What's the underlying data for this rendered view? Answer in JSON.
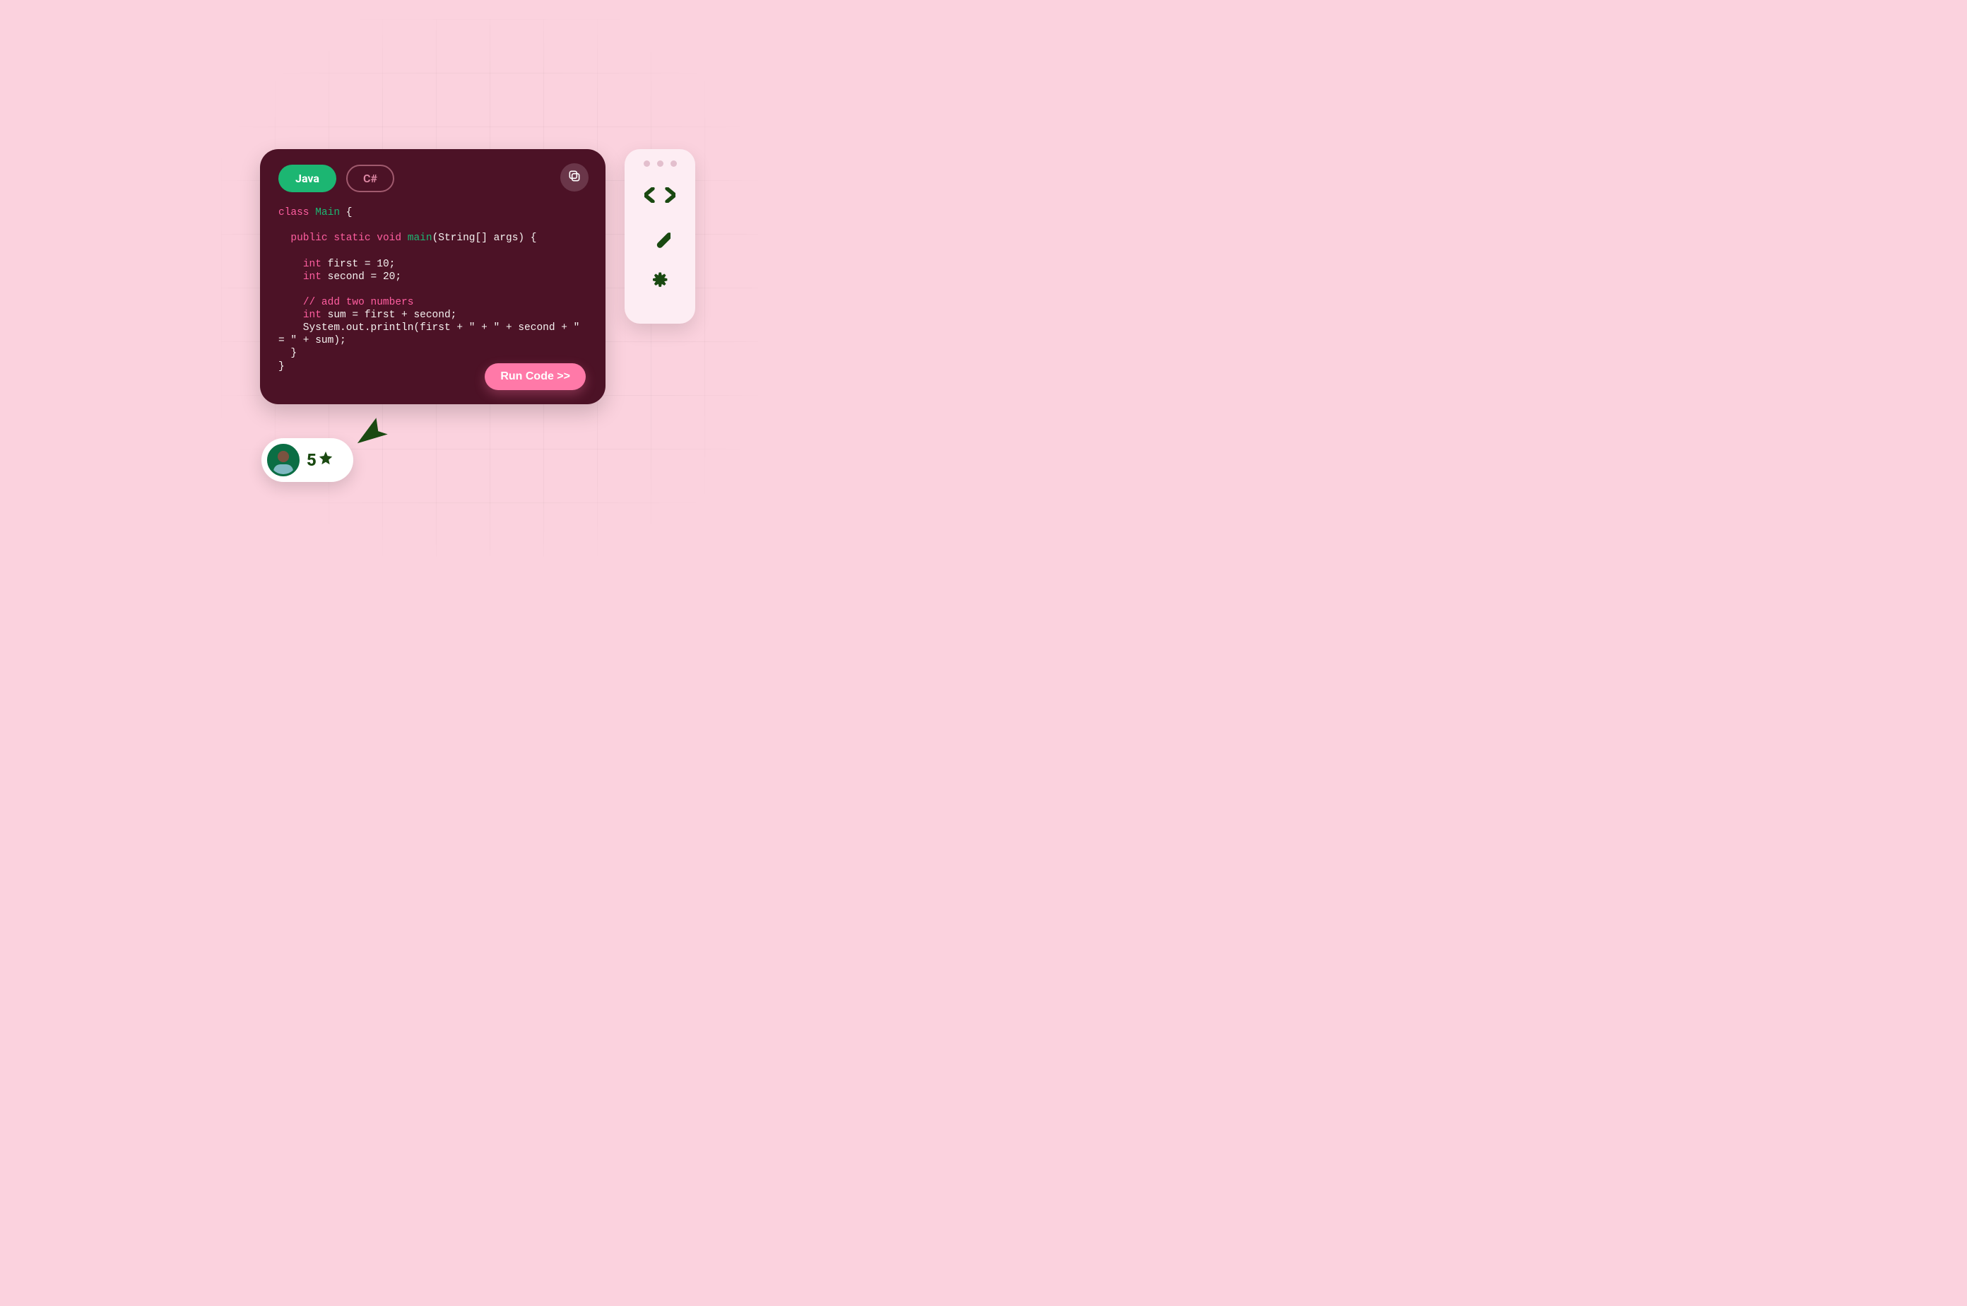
{
  "editor": {
    "tabs": [
      {
        "label": "Java",
        "active": true
      },
      {
        "label": "C#",
        "active": false
      }
    ],
    "run_label": "Run Code >>",
    "code_tokens": [
      {
        "t": "kw",
        "s": "class"
      },
      {
        "t": "",
        "s": " "
      },
      {
        "t": "type",
        "s": "Main"
      },
      {
        "t": "",
        "s": " {"
      },
      {
        "t": "nl"
      },
      {
        "t": "nl"
      },
      {
        "t": "",
        "s": "  "
      },
      {
        "t": "kw",
        "s": "public"
      },
      {
        "t": "",
        "s": " "
      },
      {
        "t": "kw",
        "s": "static"
      },
      {
        "t": "",
        "s": " "
      },
      {
        "t": "kw",
        "s": "void"
      },
      {
        "t": "",
        "s": " "
      },
      {
        "t": "fn",
        "s": "main"
      },
      {
        "t": "",
        "s": "(String[] args) {"
      },
      {
        "t": "nl"
      },
      {
        "t": "nl"
      },
      {
        "t": "",
        "s": "    "
      },
      {
        "t": "kw",
        "s": "int"
      },
      {
        "t": "",
        "s": " first = "
      },
      {
        "t": "num",
        "s": "10"
      },
      {
        "t": "",
        "s": ";"
      },
      {
        "t": "nl"
      },
      {
        "t": "",
        "s": "    "
      },
      {
        "t": "kw",
        "s": "int"
      },
      {
        "t": "",
        "s": " second = "
      },
      {
        "t": "num",
        "s": "20"
      },
      {
        "t": "",
        "s": ";"
      },
      {
        "t": "nl"
      },
      {
        "t": "nl"
      },
      {
        "t": "",
        "s": "    "
      },
      {
        "t": "cmt",
        "s": "// add two numbers"
      },
      {
        "t": "nl"
      },
      {
        "t": "",
        "s": "    "
      },
      {
        "t": "kw",
        "s": "int"
      },
      {
        "t": "",
        "s": " sum = first + second;"
      },
      {
        "t": "nl"
      },
      {
        "t": "",
        "s": "    System.out.println(first + \" + \" + second + \" "
      },
      {
        "t": "nl"
      },
      {
        "t": "",
        "s": "= \" + sum);"
      },
      {
        "t": "nl"
      },
      {
        "t": "",
        "s": "  }"
      },
      {
        "t": "nl"
      },
      {
        "t": "",
        "s": "}"
      }
    ]
  },
  "sidebar": {
    "icons": [
      {
        "name": "code-icon"
      },
      {
        "name": "edit-pen-icon"
      },
      {
        "name": "gear-icon"
      }
    ]
  },
  "rating": {
    "value": "5"
  }
}
